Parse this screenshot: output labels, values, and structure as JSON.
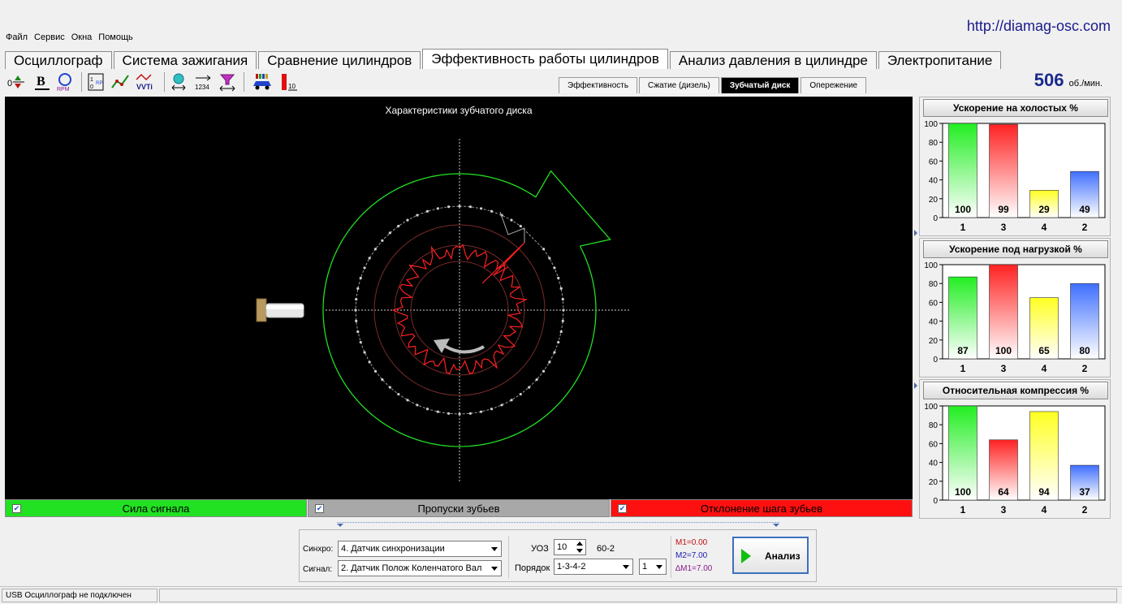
{
  "site_url": "http://diamag-osc.com",
  "menu": [
    "Файл",
    "Сервис",
    "Окна",
    "Помощь"
  ],
  "main_tabs": [
    {
      "label": "Осциллограф"
    },
    {
      "label": "Система зажигания"
    },
    {
      "label": "Сравнение цилиндров"
    },
    {
      "label": "Эффективность работы цилиндров"
    },
    {
      "label": "Анализ давления в цилиндре"
    },
    {
      "label": "Электропитание"
    }
  ],
  "toolbar": {
    "icons": [
      "zero-offset-icon",
      "bold-b-icon",
      "rpm-icon",
      "rpm-table-icon",
      "line-graph-icon",
      "vvti-icon",
      "sensor-icon",
      "numbering-icon",
      "filter-icon",
      "car-icon",
      "bar-10-icon"
    ]
  },
  "sub_tabs": [
    {
      "label": "Эффективность"
    },
    {
      "label": "Сжатие (дизель)"
    },
    {
      "label": "Зубчатый диск"
    },
    {
      "label": "Опережение"
    }
  ],
  "rpm": {
    "value": "506",
    "unit": "об./мин."
  },
  "scope": {
    "title": "Характеристики зубчатого диска"
  },
  "legend": [
    {
      "label": "Сила сигнала",
      "color": "#22e022"
    },
    {
      "label": "Пропуски зубьев",
      "color": "#a8a8a8"
    },
    {
      "label": "Отклонение шага зубьев",
      "color": "#ff1010"
    }
  ],
  "charts": [
    {
      "title": "Ускорение на холостых %",
      "categories": [
        "1",
        "3",
        "4",
        "2"
      ],
      "values": [
        100,
        99,
        29,
        49
      ]
    },
    {
      "title": "Ускорение под нагрузкой %",
      "categories": [
        "1",
        "3",
        "4",
        "2"
      ],
      "values": [
        87,
        100,
        65,
        80
      ]
    },
    {
      "title": "Относительная компрессия %",
      "categories": [
        "1",
        "3",
        "4",
        "2"
      ],
      "values": [
        100,
        64,
        94,
        37
      ]
    }
  ],
  "chart_data": [
    {
      "type": "bar",
      "title": "Ускорение на холостых %",
      "categories": [
        "1",
        "3",
        "4",
        "2"
      ],
      "values": [
        100,
        99,
        29,
        49
      ],
      "ylim": [
        0,
        100
      ],
      "yticks": [
        0,
        20,
        40,
        60,
        80,
        100
      ]
    },
    {
      "type": "bar",
      "title": "Ускорение под нагрузкой %",
      "categories": [
        "1",
        "3",
        "4",
        "2"
      ],
      "values": [
        87,
        100,
        65,
        80
      ],
      "ylim": [
        0,
        100
      ],
      "yticks": [
        0,
        20,
        40,
        60,
        80,
        100
      ]
    },
    {
      "type": "bar",
      "title": "Относительная компрессия %",
      "categories": [
        "1",
        "3",
        "4",
        "2"
      ],
      "values": [
        100,
        64,
        94,
        37
      ],
      "ylim": [
        0,
        100
      ],
      "yticks": [
        0,
        20,
        40,
        60,
        80,
        100
      ]
    }
  ],
  "bar_colors": [
    "#22ee22",
    "#ff2222",
    "#ffff22",
    "#3f6fff"
  ],
  "controls": {
    "sync_label": "Синхро:",
    "sync_value": "4.  Датчик синхронизации",
    "signal_label": "Сигнал:",
    "signal_value": "2.  Датчик Полож Коленчатого Вал",
    "uoz_label": "УОЗ",
    "uoz_value": "10",
    "teeth_value": "60-2",
    "order_label": "Порядок",
    "order_value": "1-3-4-2",
    "order_num": "1",
    "m1": "M1=0.00",
    "m2": "M2=7.00",
    "dm1": "∆M1=7.00",
    "analyze_label": "Анализ"
  },
  "status": {
    "text": "USB Осциллограф не подключен"
  }
}
